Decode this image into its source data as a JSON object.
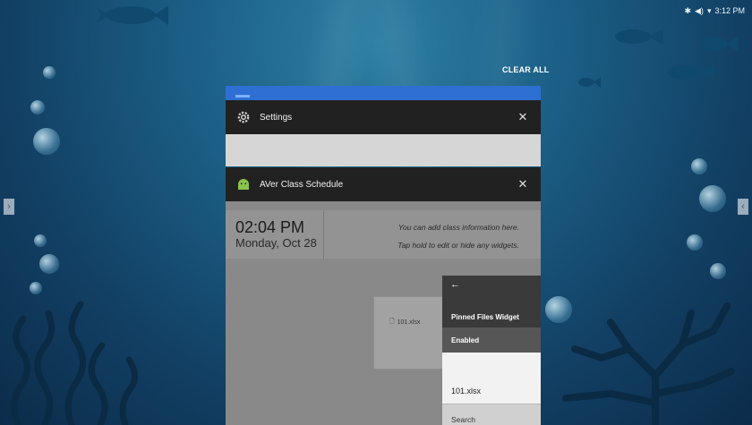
{
  "status_bar": {
    "time": "3:12 PM",
    "icons": [
      "bluetooth-icon",
      "volume-icon",
      "wifi-icon"
    ]
  },
  "recents": {
    "clear_all_label": "CLEAR ALL",
    "cards": [
      {
        "app_name": "Settings",
        "icon": "gear-icon",
        "close_icon": "close-icon"
      },
      {
        "app_name": "AVer Class Schedule",
        "icon": "android-icon",
        "close_icon": "close-icon"
      }
    ]
  },
  "aver_app": {
    "clock_time": "02:04 PM",
    "clock_date": "Monday, Oct 28",
    "hint_line_1": "You can add class information here.",
    "hint_line_2": "Tap hold to edit or hide any widgets.",
    "file_tile_name": "101.xlsx",
    "widget_panel": {
      "back_icon": "arrow-left-icon",
      "title": "Pinned Files Widget",
      "enabled_label": "Enabled",
      "file_item": "101.xlsx",
      "search_label": "Search"
    }
  },
  "nav": {
    "left_arrow_icon": "chevron-right-icon",
    "right_arrow_icon": "chevron-left-icon"
  },
  "colors": {
    "card_header": "#212121",
    "accent_blue": "#2d6fd3",
    "android_green": "#8bc34a",
    "wallpaper_top": "#2d7fa3",
    "wallpaper_bottom": "#0c2c4a"
  }
}
